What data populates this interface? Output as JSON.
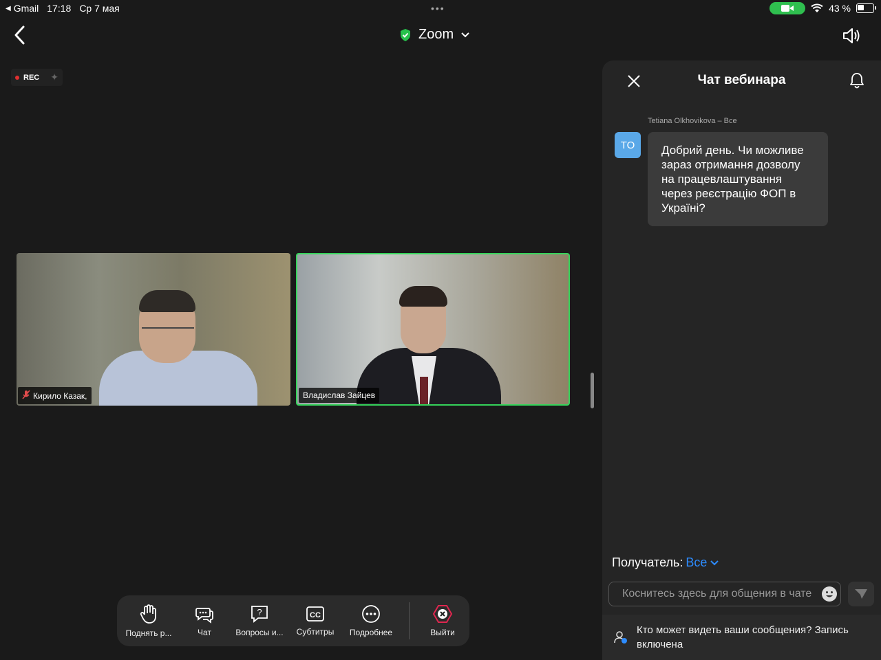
{
  "status_bar": {
    "back_app": "Gmail",
    "time": "17:18",
    "date": "Ср 7 мая",
    "battery": "43 %",
    "battery_level": 0.43,
    "dots": "•••"
  },
  "top_bar": {
    "title": "Zoom"
  },
  "stage": {
    "rec_label": "REC",
    "participants": [
      {
        "name": "Кирило Казак,",
        "muted": true
      },
      {
        "name": "Владислав Зайцев",
        "muted": false,
        "active_speaker": true
      }
    ]
  },
  "toolbar": {
    "items": [
      {
        "label": "Поднять р...",
        "icon": "raise-hand-icon"
      },
      {
        "label": "Чат",
        "icon": "chat-icon"
      },
      {
        "label": "Вопросы и...",
        "icon": "qa-icon"
      },
      {
        "label": "Субтитры",
        "icon": "cc-icon"
      },
      {
        "label": "Подробнее",
        "icon": "more-icon"
      },
      {
        "label": "Выйти",
        "icon": "leave-icon"
      }
    ]
  },
  "chat": {
    "title": "Чат вебинара",
    "message": {
      "sender": "Tetiana Olkhovikova – Все",
      "avatar_initials": "TO",
      "text": "Добрий день. Чи можливе зараз отримання дозволу на працевлаштування через реєстрацію ФОП в Україні?"
    },
    "recipient_label": "Получатель:",
    "recipient_value": "Все",
    "input_placeholder": "Коснитесь здесь для общения в чате",
    "privacy_text": "Кто может видеть ваши сообщения? Запись включена"
  },
  "colors": {
    "accent": "#2d8cff",
    "active_speaker_border": "#35d35a",
    "rec": "#e03030",
    "camera_pill": "#2fbf4f",
    "leave": "#e0264f"
  }
}
